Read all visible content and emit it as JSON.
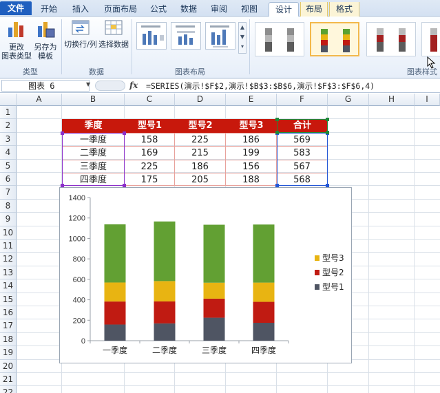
{
  "ribbon": {
    "tabs": [
      {
        "label": "文件",
        "kind": "file"
      },
      {
        "label": "开始",
        "kind": "normal"
      },
      {
        "label": "插入",
        "kind": "normal"
      },
      {
        "label": "页面布局",
        "kind": "normal"
      },
      {
        "label": "公式",
        "kind": "normal"
      },
      {
        "label": "数据",
        "kind": "normal"
      },
      {
        "label": "审阅",
        "kind": "normal"
      },
      {
        "label": "视图",
        "kind": "normal"
      },
      {
        "label": "设计",
        "kind": "active"
      },
      {
        "label": "布局",
        "kind": "ctx"
      },
      {
        "label": "格式",
        "kind": "ctx"
      }
    ],
    "buttons": {
      "change_type": "更改\n图表类型",
      "save_template": "另存为\n模板",
      "switch_rowcol": "切换行/列",
      "select_data": "选择数据"
    },
    "groups": {
      "type": "类型",
      "data": "数据",
      "layout": "图表布局",
      "styles": "图表样式"
    }
  },
  "formula_bar": {
    "name_box": "图表 6",
    "fx": "fx",
    "formula": "=SERIES(演示!$F$2,演示!$B$3:$B$6,演示!$F$3:$F$6,4)"
  },
  "sheet": {
    "columns": [
      "A",
      "B",
      "C",
      "D",
      "E",
      "F",
      "G",
      "H",
      "I"
    ],
    "rows": [
      "1",
      "2",
      "3",
      "4",
      "5",
      "6",
      "7",
      "8",
      "9",
      "10",
      "11",
      "12",
      "13",
      "14",
      "15",
      "16",
      "17",
      "18",
      "19",
      "20",
      "21",
      "22"
    ],
    "table": {
      "headers": [
        "季度",
        "型号1",
        "型号2",
        "型号3",
        "合计"
      ],
      "rows": [
        [
          "一季度",
          "158",
          "225",
          "186",
          "569"
        ],
        [
          "二季度",
          "169",
          "215",
          "199",
          "583"
        ],
        [
          "三季度",
          "225",
          "186",
          "156",
          "567"
        ],
        [
          "四季度",
          "175",
          "205",
          "188",
          "568"
        ]
      ]
    }
  },
  "chart_data": {
    "type": "bar",
    "stacked": true,
    "categories": [
      "一季度",
      "二季度",
      "三季度",
      "四季度"
    ],
    "series": [
      {
        "name": "型号1",
        "values": [
          158,
          169,
          225,
          175
        ],
        "color": "#4f5563"
      },
      {
        "name": "型号2",
        "values": [
          225,
          215,
          186,
          205
        ],
        "color": "#c01b12"
      },
      {
        "name": "型号3",
        "values": [
          186,
          199,
          156,
          188
        ],
        "color": "#e8b412"
      },
      {
        "values": [
          569,
          583,
          567,
          568
        ],
        "color": "#62a033"
      }
    ],
    "yticks": [
      "0",
      "200",
      "400",
      "600",
      "800",
      "1000",
      "1200",
      "1400"
    ],
    "ylim": [
      0,
      1400
    ],
    "legend_position": "right",
    "grid": false
  }
}
